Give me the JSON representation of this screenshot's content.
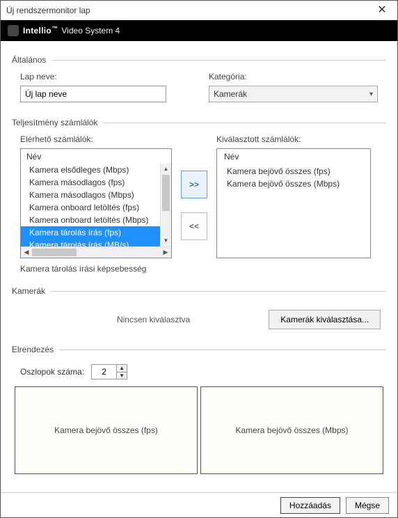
{
  "window": {
    "title": "Új rendszermonitor lap"
  },
  "brand": {
    "name": "Intellio",
    "tm": "™",
    "product": "Video System 4"
  },
  "sections": {
    "general": "Általános",
    "perf": "Teljesítmény számlálók",
    "cams": "Kamerák",
    "layout": "Elrendezés"
  },
  "general": {
    "tabname_label": "Lap neve:",
    "tabname_value": "Új lap neve",
    "category_label": "Kategória:",
    "category_value": "Kamerák"
  },
  "counters": {
    "available_label": "Elérhető számlálók:",
    "selected_label": "Kiválasztott számlálók:",
    "list_header": "Név",
    "available": [
      {
        "label": "Kamera elsődleges (Mbps)",
        "sel": false
      },
      {
        "label": "Kamera másodlagos (fps)",
        "sel": false
      },
      {
        "label": "Kamera másodlagos (Mbps)",
        "sel": false
      },
      {
        "label": "Kamera onboard letöltés (fps)",
        "sel": false
      },
      {
        "label": "Kamera onboard letöltés (Mbps)",
        "sel": false
      },
      {
        "label": "Kamera tárolás írás (fps)",
        "sel": true
      },
      {
        "label": "Kamera tárolás írás (MB/s)",
        "sel": true
      }
    ],
    "selected": [
      "Kamera bejövő összes (fps)",
      "Kamera bejövő összes (Mbps)"
    ],
    "add_label": ">>",
    "remove_label": "<<",
    "description": "Kamera tárolás írási képsebesség"
  },
  "cameras": {
    "status": "Nincsen kiválasztva",
    "select_button": "Kamerák kiválasztása..."
  },
  "layout": {
    "columns_label": "Oszlopok száma:",
    "columns_value": "2",
    "cells": [
      "Kamera bejövő összes (fps)",
      "Kamera bejövő összes (Mbps)"
    ]
  },
  "footer": {
    "add": "Hozzáadás",
    "cancel": "Mégse"
  }
}
